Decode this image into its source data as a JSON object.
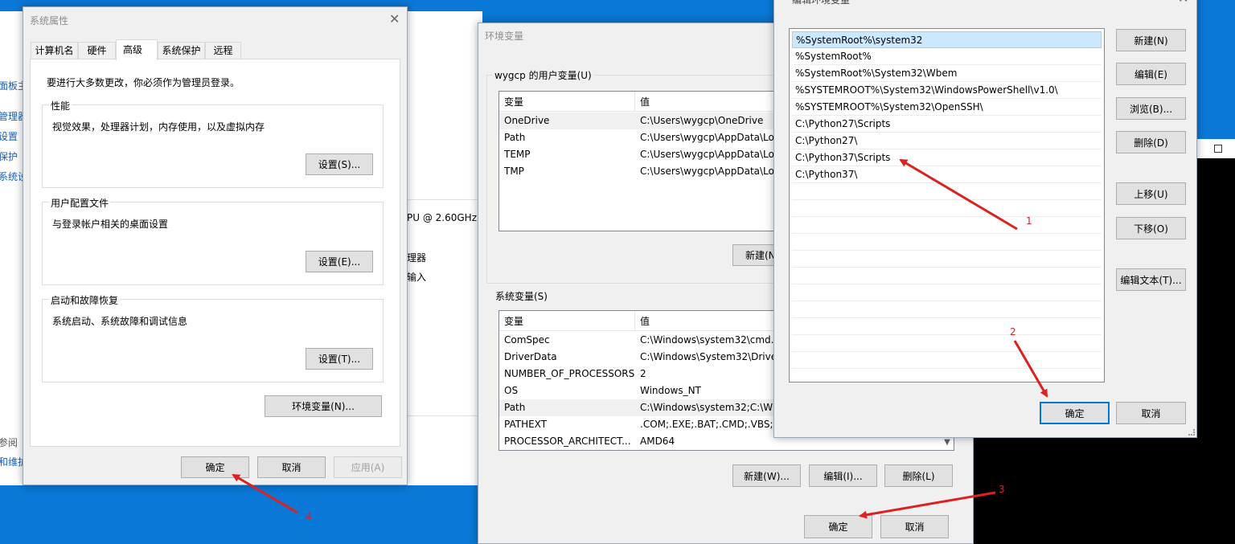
{
  "background_fragments": {
    "left_items": [
      "面板主",
      "管理器",
      "设置",
      "保护",
      "系统设"
    ],
    "cpu_text": "PU @ 2.60GHz",
    "proc_text": "理器",
    "input_text": "输入",
    "ref_text": "参阅",
    "maint_text": "和维护"
  },
  "sys_props": {
    "title": "系统属性",
    "tabs": [
      "计算机名",
      "硬件",
      "高级",
      "系统保护",
      "远程"
    ],
    "admin_note": "要进行大多数更改，你必须作为管理员登录。",
    "groups": [
      {
        "label": "性能",
        "desc": "视觉效果，处理器计划，内存使用，以及虚拟内存",
        "button": "设置(S)..."
      },
      {
        "label": "用户配置文件",
        "desc": "与登录帐户相关的桌面设置",
        "button": "设置(E)..."
      },
      {
        "label": "启动和故障恢复",
        "desc": "系统启动、系统故障和调试信息",
        "button": "设置(T)..."
      }
    ],
    "env_button": "环境变量(N)...",
    "ok": "确定",
    "cancel": "取消",
    "apply": "应用(A)"
  },
  "env_vars": {
    "title": "环境变量",
    "user_group_label": "wygcp 的用户变量(U)",
    "col_var": "变量",
    "col_val": "值",
    "user_rows": [
      {
        "name": "OneDrive",
        "value": "C:\\Users\\wygcp\\OneDrive"
      },
      {
        "name": "Path",
        "value": "C:\\Users\\wygcp\\AppData\\Lo"
      },
      {
        "name": "TEMP",
        "value": "C:\\Users\\wygcp\\AppData\\Lo"
      },
      {
        "name": "TMP",
        "value": "C:\\Users\\wygcp\\AppData\\Lo"
      }
    ],
    "user_new_button": "新建(N",
    "sys_group_label": "系统变量(S)",
    "sys_rows": [
      {
        "name": "ComSpec",
        "value": "C:\\Windows\\system32\\cmd.e"
      },
      {
        "name": "DriverData",
        "value": "C:\\Windows\\System32\\Driver"
      },
      {
        "name": "NUMBER_OF_PROCESSORS",
        "value": "2"
      },
      {
        "name": "OS",
        "value": "Windows_NT"
      },
      {
        "name": "Path",
        "value": "C:\\Windows\\system32;C:\\Win"
      },
      {
        "name": "PATHEXT",
        "value": ".COM;.EXE;.BAT;.CMD;.VBS;.V"
      },
      {
        "name": "PROCESSOR_ARCHITECT...",
        "value": "AMD64"
      }
    ],
    "sys_new_button": "新建(W)...",
    "sys_edit_button": "编辑(I)...",
    "sys_delete_button": "删除(L)",
    "ok": "确定",
    "cancel": "取消"
  },
  "edit_env": {
    "title": "编辑环境变量",
    "items": [
      "%SystemRoot%\\system32",
      "%SystemRoot%",
      "%SystemRoot%\\System32\\Wbem",
      "%SYSTEMROOT%\\System32\\WindowsPowerShell\\v1.0\\",
      "%SYSTEMROOT%\\System32\\OpenSSH\\",
      "C:\\Python27\\Scripts",
      "C:\\Python27\\",
      "C:\\Python37\\Scripts",
      "C:\\Python37\\"
    ],
    "buttons": {
      "new": "新建(N)",
      "edit": "编辑(E)",
      "browse": "浏览(B)...",
      "delete": "删除(D)",
      "up": "上移(U)",
      "down": "下移(O)",
      "edit_text": "编辑文本(T)..."
    },
    "ok": "确定",
    "cancel": "取消"
  },
  "annotations": [
    "1",
    "2",
    "3",
    "4"
  ],
  "colors": {
    "annotation": "#e02020",
    "desktop": "#0a78d7",
    "selection": "#cce8ff"
  }
}
